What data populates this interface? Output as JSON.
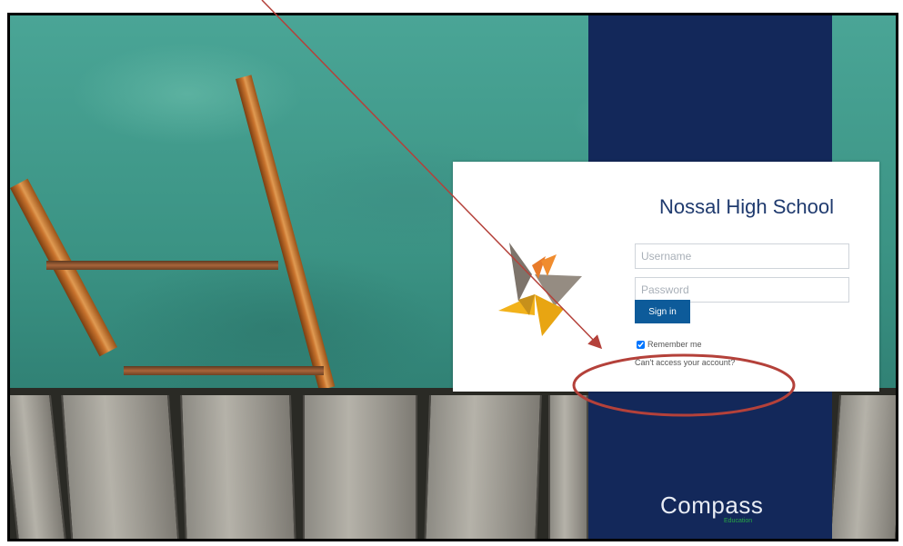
{
  "login": {
    "school_name": "Nossal High School",
    "username_placeholder": "Username",
    "password_placeholder": "Password",
    "signin_label": "Sign in",
    "remember_label": "Remember me",
    "remember_checked": true,
    "cant_access_label": "Can't access your account?"
  },
  "brand": {
    "name": "Compass",
    "sub": "Education",
    "stripe_color": "#13285a",
    "button_color": "#0d5b9a",
    "title_color": "#1f3a6e"
  },
  "annotation": {
    "color": "#b4413a"
  }
}
